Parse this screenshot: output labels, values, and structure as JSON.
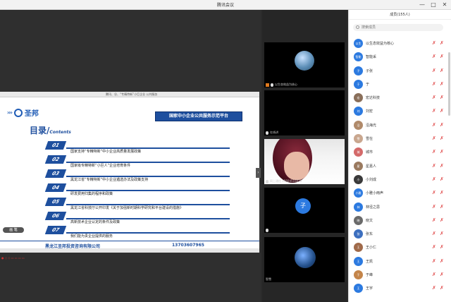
{
  "window": {
    "title": "腾讯会议",
    "controls": [
      "—",
      "□",
      "✕"
    ]
  },
  "share": {
    "top_strip": "腾讯、谷、“专精特新”小巨企业  公共服务",
    "logo_name": "圣邦",
    "banner": "国家中小企业公共服务示范平台",
    "toc_title": "目录/",
    "toc_sub": "Contents",
    "items": [
      {
        "num": "01",
        "text": "国家支持“专精特新”中小企业高质量发展政策"
      },
      {
        "num": "02",
        "text": "国家级专精特新“小巨人”企业培育条件"
      },
      {
        "num": "03",
        "text": "黑龙江省“专精特新”中小企业遴选办法及政策支持"
      },
      {
        "num": "04",
        "text": "研发费用归集的程序和政策"
      },
      {
        "num": "05",
        "text": "黑龙江省科技厅公开印发《关于加强新时期科学研究和平台建设的措施》"
      },
      {
        "num": "06",
        "text": "高新技术企业认定的条件及政策"
      },
      {
        "num": "07",
        "text": "我们能为贵企业提供的服务"
      }
    ],
    "company": "黑龙江圣邦投资咨询有限公司",
    "phone": "13703607965",
    "pen_label": "画 笔",
    "bottom_bar": "● ○ ◇ ▭ ▭ ▭ ▭"
  },
  "gallery": [
    {
      "caption": "以生态效益为核心"
    },
    {
      "caption": "在线讲"
    },
    {
      "caption": "网上通信 15604516070"
    },
    {
      "caption": "",
      "avatar_text": "子"
    },
    {
      "caption": "智雪"
    }
  ],
  "panel": {
    "title": "成员(155人)",
    "search_placeholder": "搜索成员",
    "members": [
      {
        "avatar": "以生",
        "name": "以生态效益为核心"
      },
      {
        "avatar": "智能",
        "name": "智能采"
      },
      {
        "avatar": "子",
        "name": "子张"
      },
      {
        "avatar": "于",
        "name": "于"
      },
      {
        "avatar": "宏",
        "name": "宏达科技"
      },
      {
        "avatar": "刘",
        "name": "刘宏"
      },
      {
        "avatar": "沿",
        "name": "沿海光"
      },
      {
        "avatar": "雪",
        "name": "雪在"
      },
      {
        "avatar": "城",
        "name": "城市"
      },
      {
        "avatar": "星",
        "name": "星嘉人"
      },
      {
        "avatar": "小",
        "name": "小刘成"
      },
      {
        "avatar": "小雅",
        "name": "小雅小雨声"
      },
      {
        "avatar": "林",
        "name": "林径之思"
      },
      {
        "avatar": "晓",
        "name": "晓文"
      },
      {
        "avatar": "张",
        "name": "张东"
      },
      {
        "avatar": "王",
        "name": "王小仁"
      },
      {
        "avatar": "王",
        "name": "王凯"
      },
      {
        "avatar": "于",
        "name": "于峰"
      },
      {
        "avatar": "王",
        "name": "王宇"
      }
    ]
  }
}
